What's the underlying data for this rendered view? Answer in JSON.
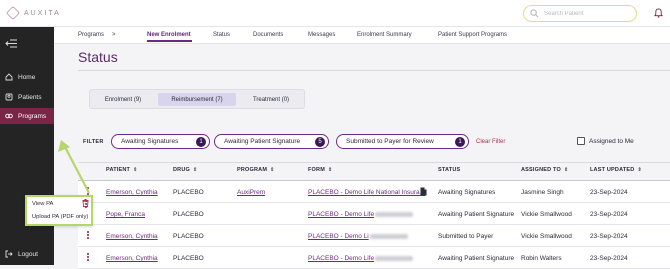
{
  "brand": {
    "name": "AUXITA"
  },
  "search": {
    "placeholder": "Search Patient"
  },
  "icons": {
    "search": "search-icon",
    "notifications": "bell-icon",
    "collapse": "collapse-menu-icon",
    "home": "home-icon",
    "patients": "patients-icon",
    "programs": "programs-icon",
    "logout": "logout-icon",
    "delete": "trash-icon",
    "document": "document-icon",
    "more": "kebab-menu-icon"
  },
  "colors": {
    "accent": "#6b2a84",
    "sidebar_bg": "#242424",
    "sidebar_active": "#7a2446",
    "danger": "#b3314a",
    "highlight": "#b6d56b"
  },
  "sidebar": {
    "items": [
      {
        "label": "Home"
      },
      {
        "label": "Patients"
      },
      {
        "label": "Programs"
      }
    ],
    "logout": "Logout"
  },
  "nav": {
    "tabs": [
      {
        "label": "Programs"
      },
      {
        "label": "New Enrolment"
      },
      {
        "label": "Status"
      },
      {
        "label": "Documents"
      },
      {
        "label": "Messages"
      },
      {
        "label": "Enrolment Summary"
      },
      {
        "label": "Patient Support Programs"
      }
    ],
    "breadcrumb_separator": ">"
  },
  "page": {
    "title": "Status"
  },
  "status_tabs": [
    {
      "label": "Enrolment (9)"
    },
    {
      "label": "Reimbursement (7)"
    },
    {
      "label": "Treatment (0)"
    }
  ],
  "filter": {
    "label": "FILTER",
    "pills": [
      {
        "label": "Awaiting Signatures",
        "count": "1"
      },
      {
        "label": "Awaiting Patient Signature",
        "count": "5"
      },
      {
        "label": "Submitted to Payer for Review",
        "count": "1"
      }
    ],
    "clear": "Clear Filter",
    "assigned_to_me": "Assigned to Me"
  },
  "table": {
    "columns": [
      "PATIENT",
      "DRUG",
      "PROGRAM",
      "FORM",
      "STATUS",
      "ASSIGNED TO",
      "LAST UPDATED"
    ],
    "rows": [
      {
        "patient": "Emerson, Cynthia",
        "drug": "PLACEBO",
        "program": "AuxiPrem",
        "form": "PLACEBO - Demo Life National Insura...",
        "status": "Awaiting Signatures",
        "assigned": "Jasmine Singh",
        "updated": "23-Sep-2024"
      },
      {
        "patient": "Pope, Franca",
        "drug": "PLACEBO",
        "program": "",
        "form": "PLACEBO - Demo Life",
        "status": "Awaiting Patient Signature",
        "assigned": "Vickie Smallwood",
        "updated": "23-Sep-2024"
      },
      {
        "patient": "Emerson, Cynthia",
        "drug": "PLACEBO",
        "program": "",
        "form": "PLACEBO - Demo Li",
        "status": "Submitted to Payer",
        "assigned": "Vickie Smallwood",
        "updated": "23-Sep-2024"
      },
      {
        "patient": "Emerson, Cynthia",
        "drug": "PLACEBO",
        "program": "",
        "form": "PLACEBO - Demo Life",
        "status": "Awaiting Patient Signature",
        "assigned": "Robin Walters",
        "updated": "23-Sep-2024"
      }
    ]
  },
  "row_menu": {
    "items": [
      {
        "label": "View PA"
      },
      {
        "label": "Upload PA (PDF only)"
      }
    ]
  }
}
